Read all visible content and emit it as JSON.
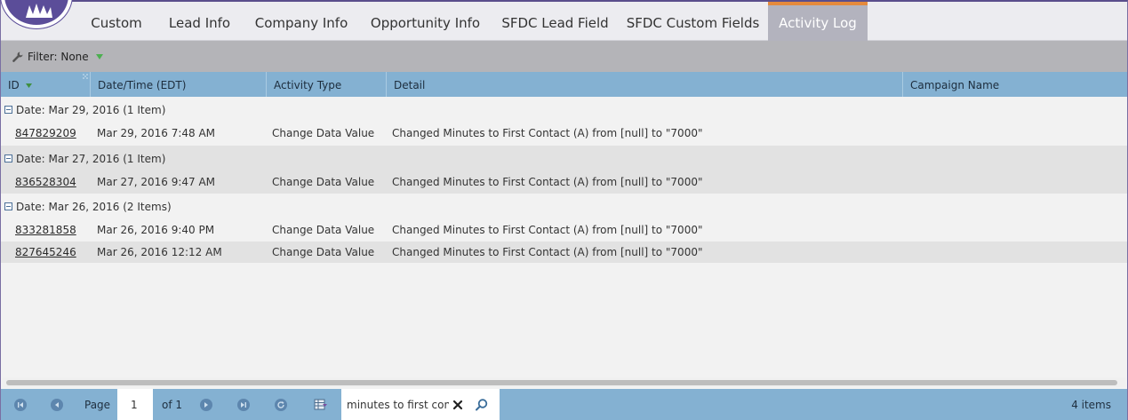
{
  "tabs": [
    {
      "label": "Custom",
      "active": false
    },
    {
      "label": "Lead Info",
      "active": false
    },
    {
      "label": "Company Info",
      "active": false
    },
    {
      "label": "Opportunity Info",
      "active": false
    },
    {
      "label": "SFDC Lead Field",
      "active": false
    },
    {
      "label": "SFDC Custom Fields",
      "active": false
    },
    {
      "label": "Activity Log",
      "active": true
    }
  ],
  "filter": {
    "label": "Filter: None"
  },
  "columns": {
    "id": "ID",
    "datetime": "Date/Time (EDT)",
    "activity_type": "Activity Type",
    "detail": "Detail",
    "campaign": "Campaign Name"
  },
  "groups": [
    {
      "label": "Date: Mar 29, 2016 (1 Item)",
      "rows": [
        {
          "id": "847829209",
          "datetime": "Mar 29, 2016 7:48 AM",
          "activity_type": "Change Data Value",
          "detail": "Changed Minutes to First Contact (A) from [null] to \"7000\""
        }
      ]
    },
    {
      "label": "Date: Mar 27, 2016 (1 Item)",
      "rows": [
        {
          "id": "836528304",
          "datetime": "Mar 27, 2016 9:47 AM",
          "activity_type": "Change Data Value",
          "detail": "Changed Minutes to First Contact (A) from [null] to \"7000\""
        }
      ]
    },
    {
      "label": "Date: Mar 26, 2016 (2 Items)",
      "rows": [
        {
          "id": "833281858",
          "datetime": "Mar 26, 2016 9:40 PM",
          "activity_type": "Change Data Value",
          "detail": "Changed Minutes to First Contact (A) from [null] to \"7000\""
        },
        {
          "id": "827645246",
          "datetime": "Mar 26, 2016 12:12 AM",
          "activity_type": "Change Data Value",
          "detail": "Changed Minutes to First Contact (A) from [null] to \"7000\""
        }
      ]
    }
  ],
  "footer": {
    "page_label": "Page",
    "page_value": "1",
    "of_label": "of 1",
    "search_value": "minutes to first contact",
    "count_label": "4 items"
  },
  "icons": {
    "filter": "wrench-icon",
    "first": "first-page-icon",
    "prev": "prev-page-icon",
    "next": "next-page-icon",
    "last": "last-page-icon",
    "refresh": "refresh-icon",
    "export": "export-icon",
    "clear": "clear-icon",
    "search": "search-icon"
  },
  "colors": {
    "accent_orange": "#e58a3c",
    "brand_purple": "#5b4d99",
    "header_blue": "#84b1d2"
  }
}
